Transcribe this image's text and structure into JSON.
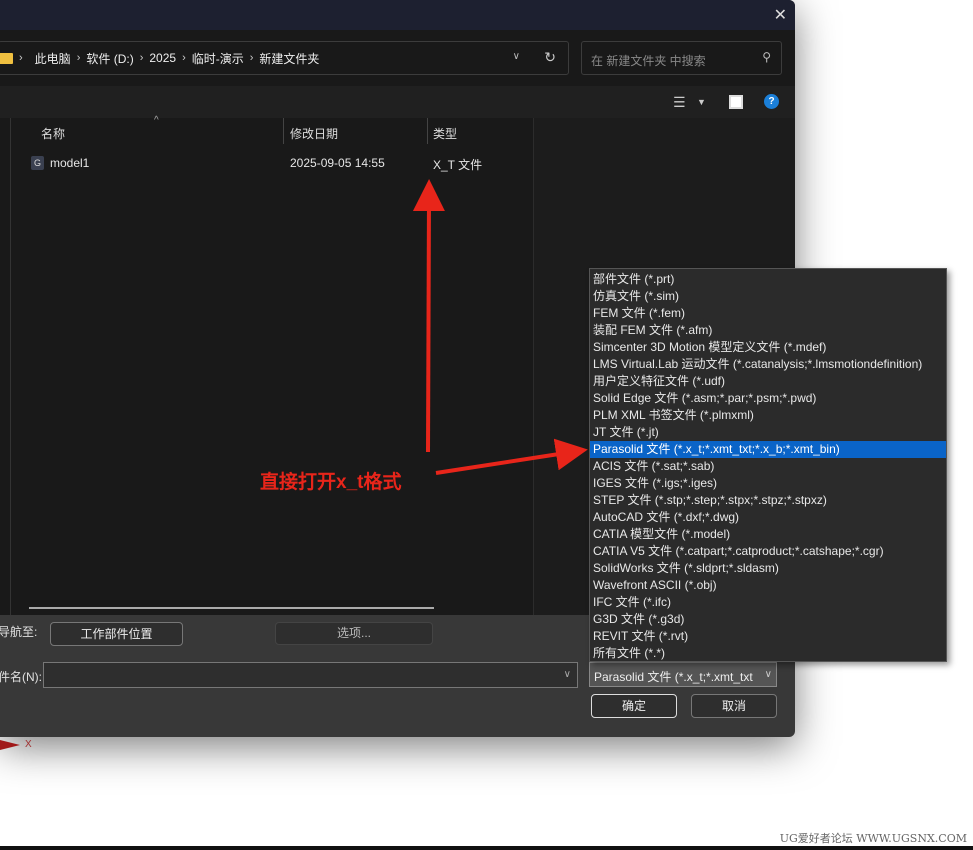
{
  "titlebar": {
    "close": "✕"
  },
  "breadcrumb": [
    "此电脑",
    "软件 (D:)",
    "2025",
    "临时-演示",
    "新建文件夹"
  ],
  "search": {
    "placeholder": "在 新建文件夹 中搜索"
  },
  "columns": {
    "name": "名称",
    "modified": "修改日期",
    "type": "类型"
  },
  "files": [
    {
      "icon": "G",
      "name": "model1",
      "modified": "2025-09-05 14:55",
      "type": "X_T 文件"
    }
  ],
  "bottom": {
    "navigate_label": "导航至:",
    "work_part_button": "工作部件位置",
    "options_button": "选项...",
    "filename_label": "件名(N):",
    "filename_value": "",
    "filetype_value": "Parasolid 文件 (*.x_t;*.xmt_txt",
    "ok": "确定",
    "cancel": "取消"
  },
  "filetypes": [
    "部件文件 (*.prt)",
    "仿真文件 (*.sim)",
    "FEM 文件 (*.fem)",
    "装配 FEM 文件 (*.afm)",
    "Simcenter 3D Motion 模型定义文件 (*.mdef)",
    "LMS Virtual.Lab 运动文件 (*.catanalysis;*.lmsmotiondefinition)",
    "用户定义特征文件 (*.udf)",
    "Solid Edge 文件 (*.asm;*.par;*.psm;*.pwd)",
    "PLM XML 书签文件 (*.plmxml)",
    "JT 文件 (*.jt)",
    "Parasolid 文件 (*.x_t;*.xmt_txt;*.x_b;*.xmt_bin)",
    "ACIS 文件 (*.sat;*.sab)",
    "IGES 文件 (*.igs;*.iges)",
    "STEP 文件 (*.stp;*.step;*.stpx;*.stpz;*.stpxz)",
    "AutoCAD 文件 (*.dxf;*.dwg)",
    "CATIA 模型文件 (*.model)",
    "CATIA V5 文件  (*.catpart;*.catproduct;*.catshape;*.cgr)",
    "SolidWorks 文件 (*.sldprt;*.sldasm)",
    "Wavefront ASCII (*.obj)",
    "IFC 文件 (*.ifc)",
    "G3D 文件 (*.g3d)",
    "REVIT 文件 (*.rvt)",
    "所有文件 (*.*)"
  ],
  "selected_filetype_index": 10,
  "annotation": "直接打开x_t格式",
  "axis_label": "X",
  "watermark": "UG爱好者论坛 WWW.UGSNX.COM",
  "colors": {
    "accent": "#0a64c8",
    "annotation": "#e8251a"
  }
}
